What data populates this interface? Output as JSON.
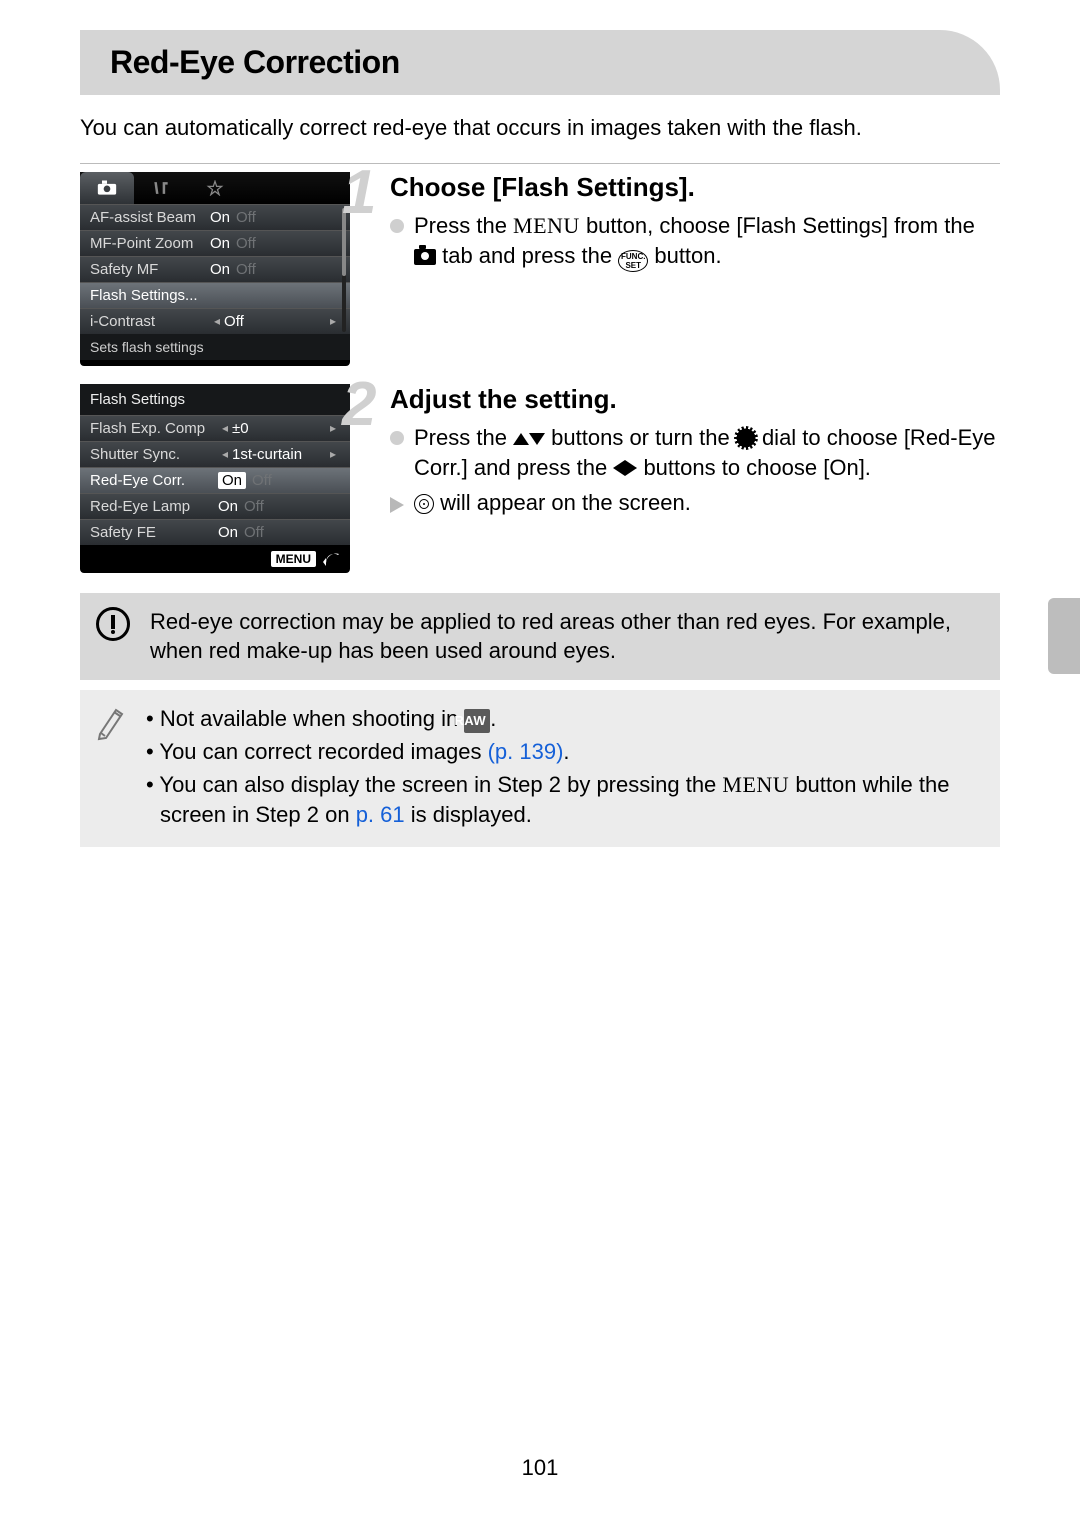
{
  "title": "Red-Eye Correction",
  "intro": "You can automatically correct red-eye that occurs in images taken with the flash.",
  "page_number": "101",
  "lcd1": {
    "tabs": [
      "camera",
      "tools",
      "star"
    ],
    "rows": [
      {
        "label": "AF-assist Beam",
        "on": "On",
        "off": "Off"
      },
      {
        "label": "MF-Point Zoom",
        "on": "On",
        "off": "Off"
      },
      {
        "label": "Safety MF",
        "on": "On",
        "off": "Off"
      },
      {
        "label": "Flash Settings...",
        "value": ""
      },
      {
        "label": "i-Contrast",
        "value": "Off",
        "arrows": true
      }
    ],
    "caption": "Sets flash settings"
  },
  "lcd2": {
    "title": "Flash Settings",
    "rows": [
      {
        "label": "Flash Exp. Comp",
        "value": "±0",
        "arrows": true
      },
      {
        "label": "Shutter Sync.",
        "value": "1st-curtain",
        "arrows": true
      },
      {
        "label": "Red-Eye Corr.",
        "on": "On",
        "off": "Off",
        "hl": true
      },
      {
        "label": "Red-Eye Lamp",
        "on": "On",
        "off": "Off"
      },
      {
        "label": "Safety FE",
        "on": "On",
        "off": "Off"
      }
    ],
    "footer_menu": "MENU"
  },
  "step1": {
    "title": "Choose [Flash Settings].",
    "body_a": "Press the ",
    "body_b": " button, choose [Flash Settings] from the ",
    "body_c": " tab and press the ",
    "body_d": " button.",
    "menu": "MENU",
    "func": "FUNC.\nSET"
  },
  "step2": {
    "title": "Adjust the setting.",
    "body_a": "Press the ",
    "body_b": " buttons or turn the ",
    "body_c": " dial to choose [Red-Eye Corr.] and press the ",
    "body_d": " buttons to choose [On].",
    "result": " will appear on the screen."
  },
  "warning": "Red-eye correction may be applied to red areas other than red eyes. For example, when red make-up has been used around eyes.",
  "notes": {
    "n1a": "Not available when shooting in ",
    "n1_raw": "RAW",
    "n1b": ".",
    "n2a": "You can correct recorded images ",
    "n2_link": "(p. 139)",
    "n2b": ".",
    "n3a": "You can also display the screen in Step 2 by pressing the ",
    "n3_menu": "MENU",
    "n3b": " button while the screen in Step 2 on ",
    "n3_link": "p. 61",
    "n3c": " is displayed."
  }
}
